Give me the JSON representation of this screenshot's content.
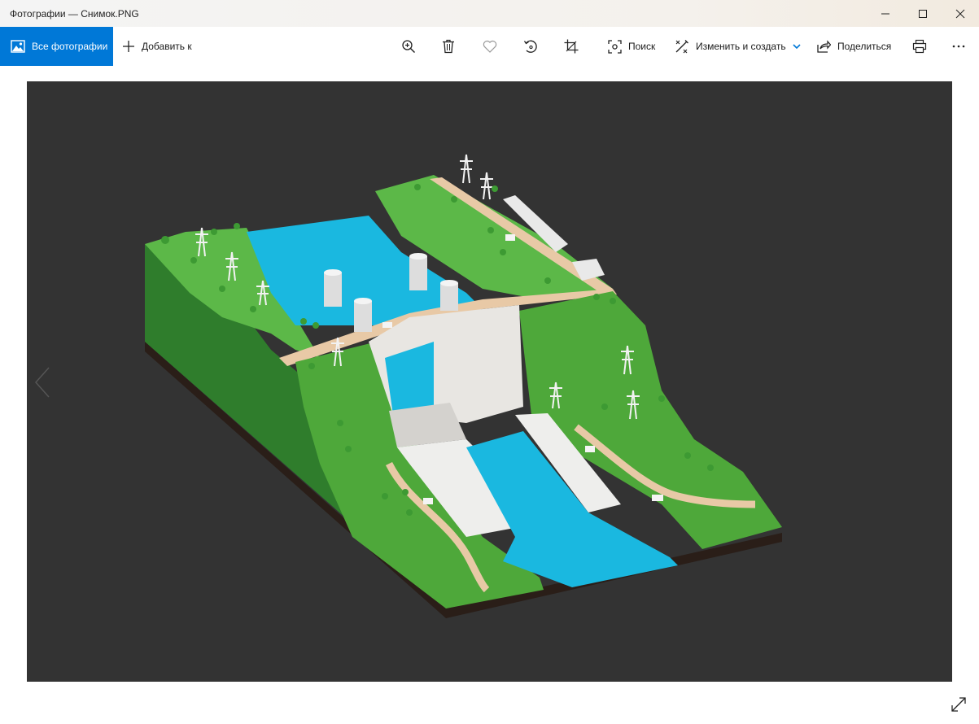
{
  "window": {
    "title": "Фотографии — Снимок.PNG"
  },
  "toolbar": {
    "all_photos_label": "Все фотографии",
    "add_to_label": "Добавить к",
    "search_label": "Поиск",
    "edit_create_label": "Изменить и создать",
    "share_label": "Поделиться"
  },
  "icons": {
    "photos": "image-icon",
    "add": "plus-icon",
    "zoom": "zoom-in-icon",
    "delete": "trash-icon",
    "favorite": "heart-icon",
    "rotate": "rotate-icon",
    "crop": "crop-icon",
    "search": "search-icon",
    "edit": "edit-create-icon",
    "share": "share-icon",
    "print": "printer-icon",
    "more": "more-icon"
  },
  "colors": {
    "accent": "#0078d7",
    "viewer_background": "#333333",
    "water": "#1ab8e0",
    "grass": "#4ea83a"
  }
}
